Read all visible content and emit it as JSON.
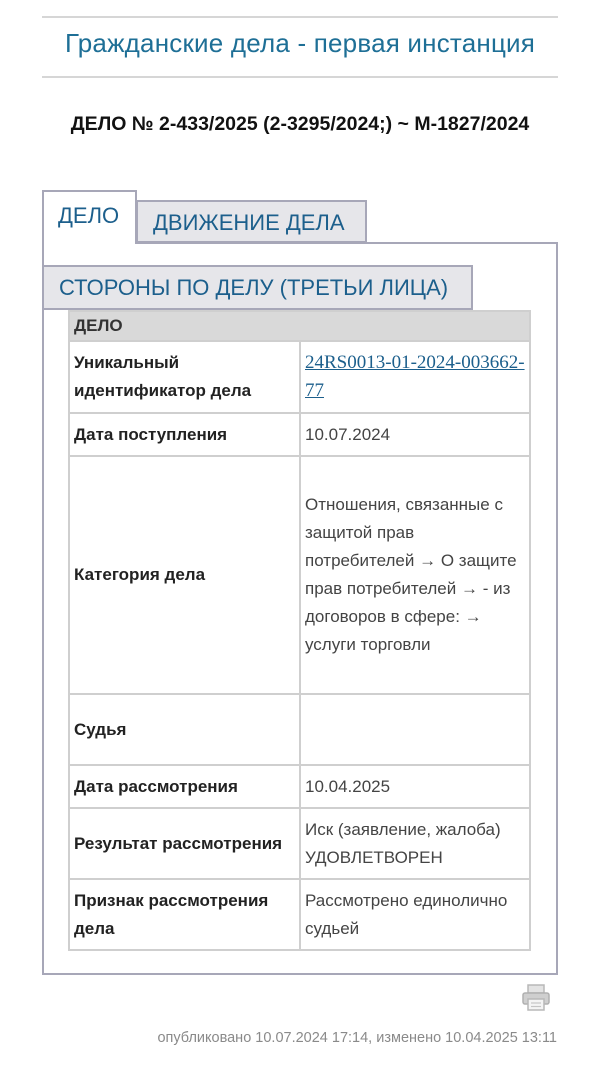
{
  "page": {
    "title": "Гражданские дела - первая инстанция",
    "case_number": "ДЕЛО № 2-433/2025 (2-3295/2024;) ~ М-1827/2024"
  },
  "tabs": [
    {
      "label": "ДЕЛО",
      "active": true
    },
    {
      "label": "ДВИЖЕНИЕ ДЕЛА",
      "active": false
    },
    {
      "label": "СТОРОНЫ ПО ДЕЛУ (ТРЕТЬИ ЛИЦА)",
      "active": false
    }
  ],
  "case_table": {
    "header": "ДЕЛО",
    "rows": [
      {
        "label": "Уникальный идентификатор дела",
        "value": "24RS0013-01-2024-003662-77"
      },
      {
        "label": "Дата поступления",
        "value": "10.07.2024"
      },
      {
        "label": "Категория дела",
        "value": "Отношения, связанные с защитой прав потребителей → О защите прав потребителей → - из договоров в сфере: → услуги торговли"
      },
      {
        "label": "Судья",
        "value": ""
      },
      {
        "label": "Дата рассмотрения",
        "value": "10.04.2025"
      },
      {
        "label": "Результат рассмотрения",
        "value": "Иск (заявление, жалоба) УДОВЛЕТВОРЕН"
      },
      {
        "label": "Признак рассмотрения дела",
        "value": "Рассмотрено единолично судьей"
      }
    ]
  },
  "footer": {
    "text": "опубликовано 10.07.2024 17:14, изменено 10.04.2025 13:11",
    "print_icon": "printer-icon"
  },
  "colors": {
    "accent": "#1e6f96",
    "link": "#1c5f8c",
    "tab_border": "#a7a7b8",
    "table_header_bg": "#d9d9d9"
  }
}
